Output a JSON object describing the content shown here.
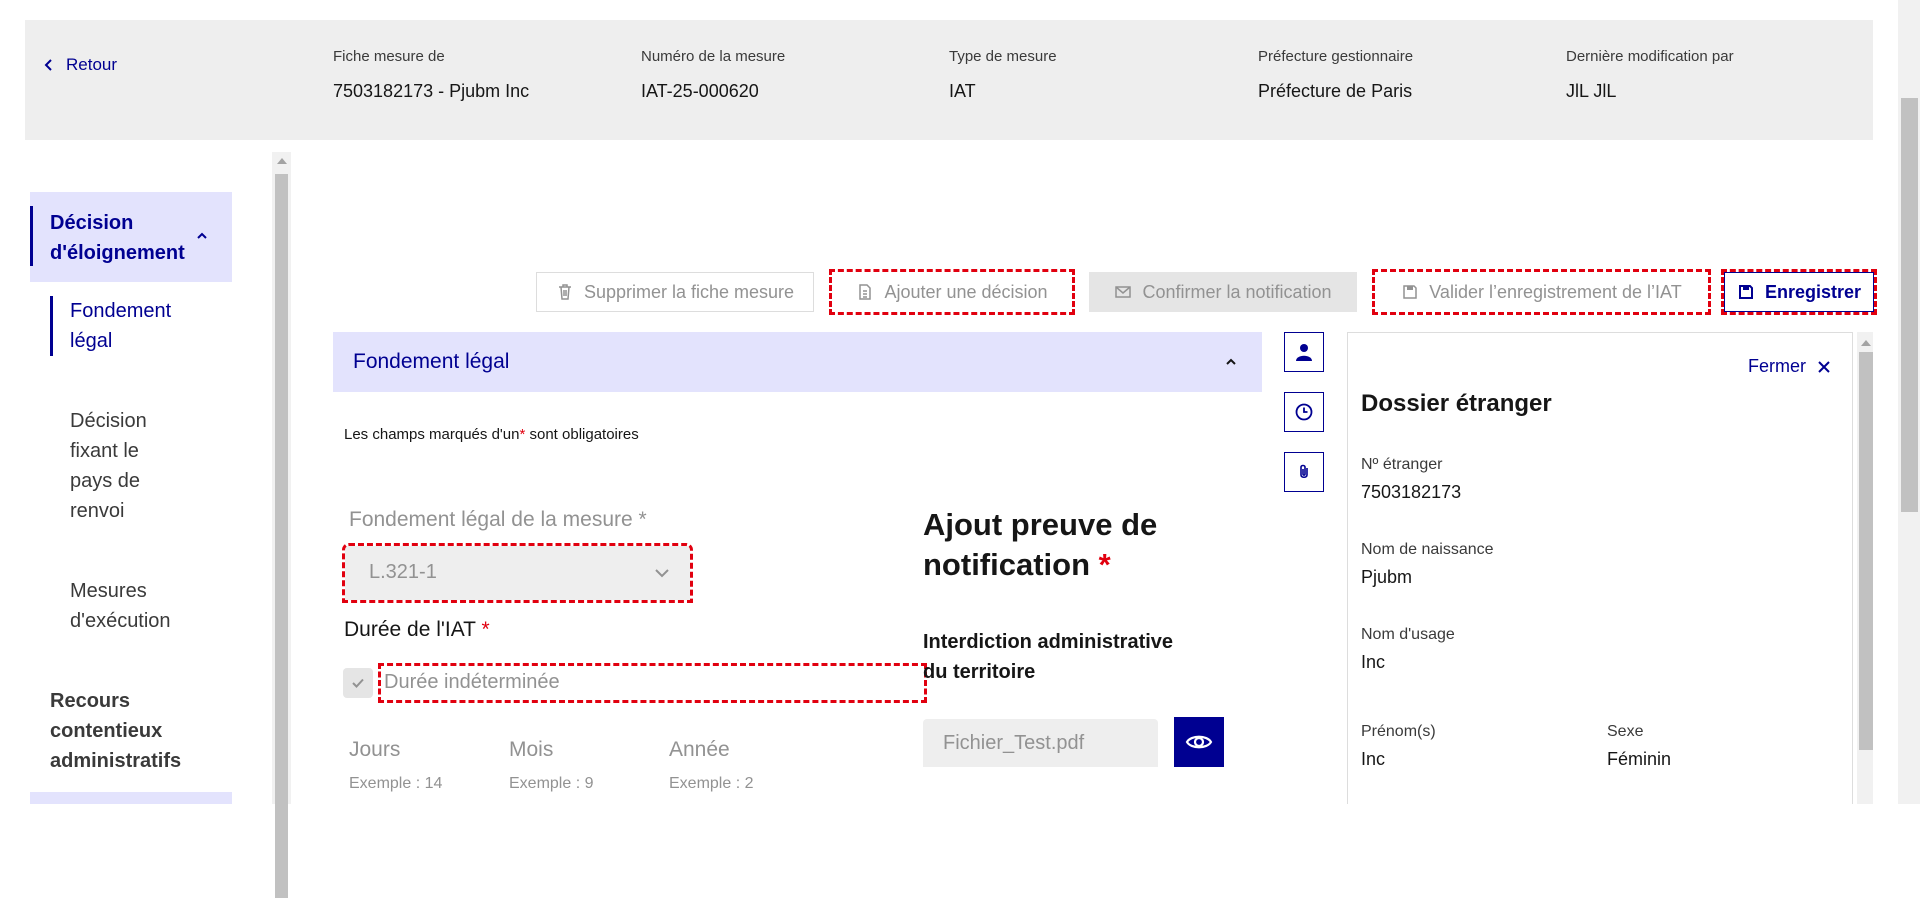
{
  "header": {
    "back_label": "Retour",
    "fields": [
      {
        "label": "Fiche mesure de",
        "value": "7503182173 - Pjubm Inc"
      },
      {
        "label": "Numéro de la mesure",
        "value": "IAT-25-000620"
      },
      {
        "label": "Type de mesure",
        "value": "IAT"
      },
      {
        "label": "Préfecture gestionnaire",
        "value": "Préfecture de Paris"
      },
      {
        "label": "Dernière modification par",
        "value": "JlL JlL"
      }
    ]
  },
  "sidebar": {
    "section_title": "Décision d'éloignement",
    "items": [
      {
        "label": "Fondement légal"
      },
      {
        "label": "Décision fixant le pays de renvoi"
      },
      {
        "label": "Mesures d'exécution"
      }
    ],
    "next_section": "Recours contentieux administratifs"
  },
  "toolbar": {
    "delete_label": "Supprimer la fiche mesure",
    "add_decision_label": "Ajouter une décision",
    "confirm_label": "Confirmer la notification",
    "validate_label": "Valider l’enregistrement de l’IAT",
    "save_label": "Enregistrer"
  },
  "accordion": {
    "title": "Fondement légal"
  },
  "form": {
    "hint_before": "Les champs marqués d'un",
    "hint_after": "sont obligatoires",
    "required_mark": "*",
    "legal_basis_label": "Fondement légal de la mesure",
    "legal_basis_value": "L.321-1",
    "duration_label": "Durée de l'IAT",
    "undetermined_label": "Durée indéterminée",
    "columns": [
      {
        "label": "Jours",
        "hint": "Exemple : 14"
      },
      {
        "label": "Mois",
        "hint": "Exemple : 9"
      },
      {
        "label": "Année",
        "hint": "Exemple : 2"
      }
    ]
  },
  "proof": {
    "title_line1": "Ajout preuve de",
    "title_line2": "notification",
    "subtitle_line1": "Interdiction administrative",
    "subtitle_line2": "du territoire",
    "file_name": "Fichier_Test.pdf"
  },
  "dossier": {
    "close_label": "Fermer",
    "title": "Dossier étranger",
    "fields": {
      "foreigner_number": {
        "label": "Nº étranger",
        "value": "7503182173"
      },
      "birth_name": {
        "label": "Nom de naissance",
        "value": "Pjubm"
      },
      "usage_name": {
        "label": "Nom d'usage",
        "value": "Inc"
      },
      "first_names": {
        "label": "Prénom(s)",
        "value": "Inc"
      },
      "sex": {
        "label": "Sexe",
        "value": "Féminin"
      }
    }
  },
  "colors": {
    "primary": "#000091",
    "accent_bg": "#e3e3fd",
    "required": "#e1000f",
    "disabled": "#929292"
  },
  "icons": [
    "chevron-left-icon",
    "chevron-up-icon",
    "trash-icon",
    "document-icon",
    "mail-icon",
    "floppy-disk-icon",
    "chevron-down-icon",
    "checkmark-icon",
    "eye-icon",
    "user-icon",
    "clock-icon",
    "paperclip-icon",
    "close-icon"
  ]
}
